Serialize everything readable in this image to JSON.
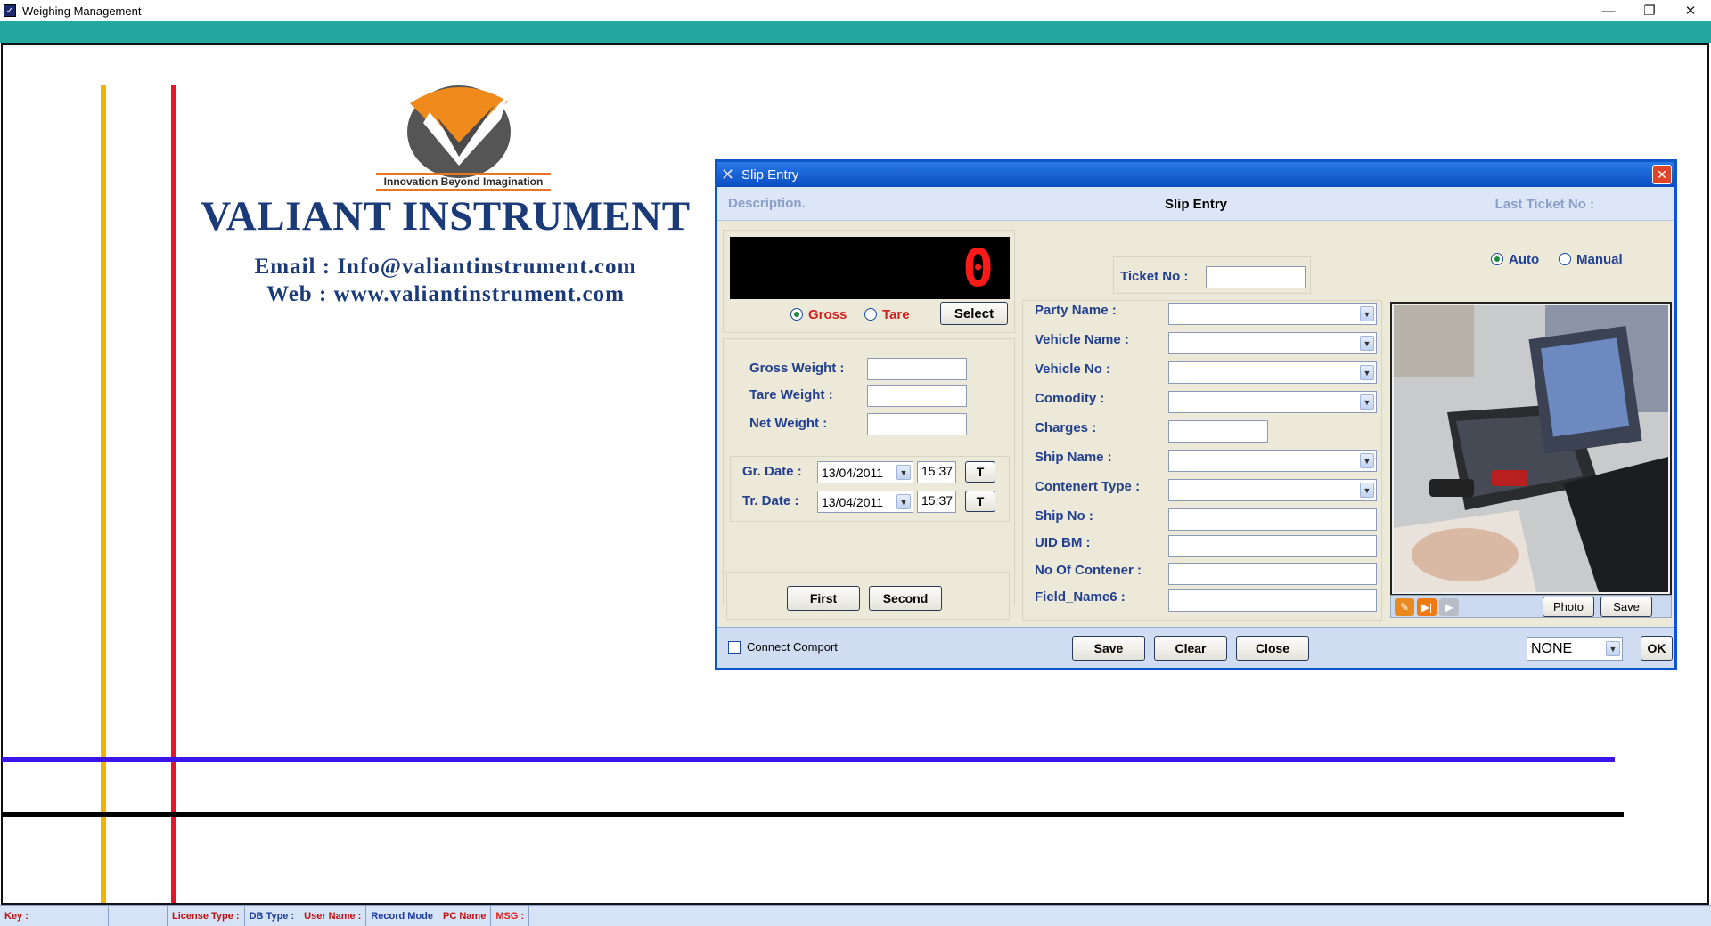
{
  "window": {
    "title": "Weighing Management"
  },
  "branding": {
    "tagline": "Innovation Beyond Imagination",
    "company": "VALIANT INSTRUMENT",
    "email": "Email : Info@valiantinstrument.com",
    "web": "Web : www.valiantinstrument.com"
  },
  "dialog": {
    "title": "Slip Entry",
    "description": "Description.",
    "header_title": "Slip Entry",
    "last_ticket_label": "Last Ticket No :",
    "display_value": "0",
    "weigh_mode": {
      "gross": "Gross",
      "tare": "Tare",
      "selected": "Gross"
    },
    "select_label": "Select",
    "gross_weight_label": "Gross Weight :",
    "tare_weight_label": "Tare Weight :",
    "net_weight_label": "Net Weight :",
    "gross_weight": "",
    "tare_weight": "",
    "net_weight": "",
    "gr_date_label": "Gr. Date :",
    "tr_date_label": "Tr. Date :",
    "gr_date": "13/04/2011",
    "gr_time": "15:37",
    "tr_date": "13/04/2011",
    "tr_time": "15:37",
    "t_label": "T",
    "first_label": "First",
    "second_label": "Second",
    "ticket_no_label": "Ticket No :",
    "ticket_no": "",
    "ticket_mode": {
      "auto": "Auto",
      "manual": "Manual",
      "selected": "Auto"
    },
    "fields": {
      "party_name": "Party Name :",
      "vehicle_name": "Vehicle Name :",
      "vehicle_no": "Vehicle No :",
      "comodity": "Comodity :",
      "charges": "Charges :",
      "ship_name": "Ship Name :",
      "contenert_type": "Contenert Type :",
      "ship_no": "Ship No :",
      "uid_bm": "UID BM :",
      "no_of_contener": "No Of Contener :",
      "field_name6": "Field_Name6 :"
    },
    "photo_label": "Photo",
    "cam_save_label": "Save",
    "connect_comport_label": "Connect Comport",
    "save_label": "Save",
    "clear_label": "Clear",
    "close_label": "Close",
    "print_option": "NONE",
    "ok_label": "OK"
  },
  "status_bar": {
    "key": "Key :",
    "license_type": "License Type :",
    "db_type": "DB Type :",
    "user_name": "User Name :",
    "record_mode": "Record Mode",
    "pc_name": "PC Name",
    "msg": "MSG :"
  },
  "colors": {
    "teal_bar": "#24a7a0",
    "dialog_border": "#0b56c8",
    "brand_blue": "#1a3a78",
    "brand_orange": "#e87722"
  },
  "icons": [
    "app-icon",
    "minimize-icon",
    "restore-icon",
    "close-icon",
    "dialog-icon",
    "wrench-icon",
    "next-icon",
    "play-icon",
    "chevron-down-icon"
  ]
}
